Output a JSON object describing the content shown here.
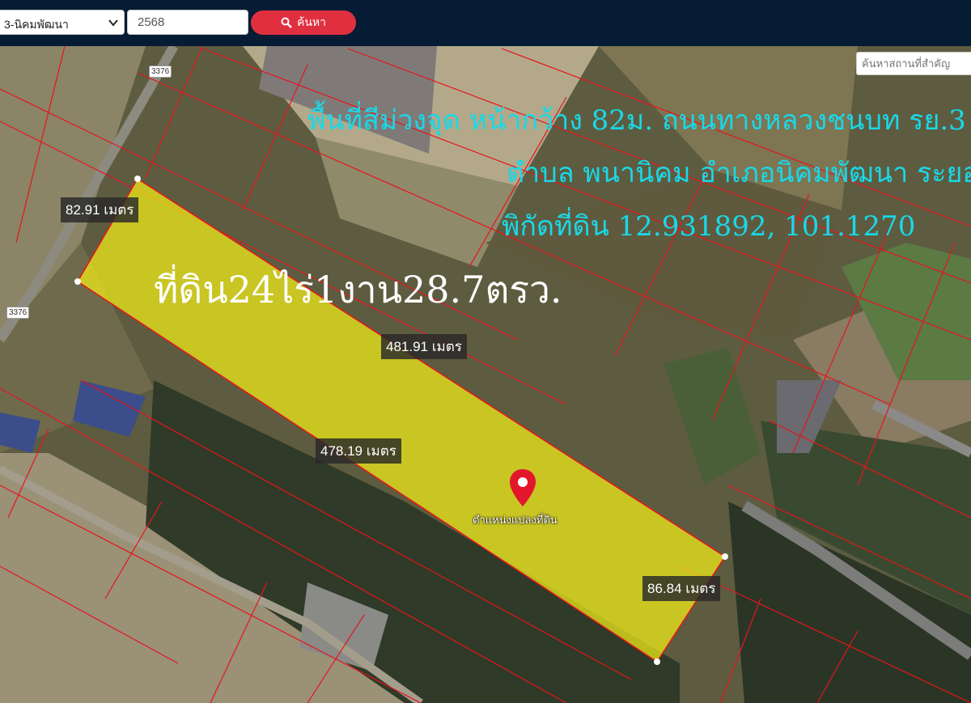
{
  "toolbar": {
    "district_value": "3-นิคมพัฒนา",
    "year_value": "2568",
    "search_button": "ค้นหา"
  },
  "map": {
    "place_search_placeholder": "ค้นหาสถานที่สำคัญ",
    "annotation_line1": "พื้นที่สีม่วงจุด หน้ากว้าง 82ม. ถนนทางหลวงชนบท รย.3",
    "annotation_line2": "ตำบล พนานิคม อำเภอนิคมพัฒนา ระยอง",
    "annotation_line3": "พิกัดที่ดิน 12.931892, 101.1270",
    "area_label": "ที่ดิน24ไร่1งาน28.7ตรว.",
    "measure_top": "82.91 เมตร",
    "measure_north": "481.91 เมตร",
    "measure_south": "478.19 เมตร",
    "measure_east": "86.84 เมตร",
    "route_number_1": "3376",
    "route_number_2": "3376",
    "pin_label": "ตำแหน่งแปลงที่ดิน"
  },
  "colors": {
    "topbar": "#061c34",
    "search_button": "#e03040",
    "parcel_fill": "#f2ee18",
    "boundary": "#e8141c",
    "annotation": "#19d8e8"
  }
}
